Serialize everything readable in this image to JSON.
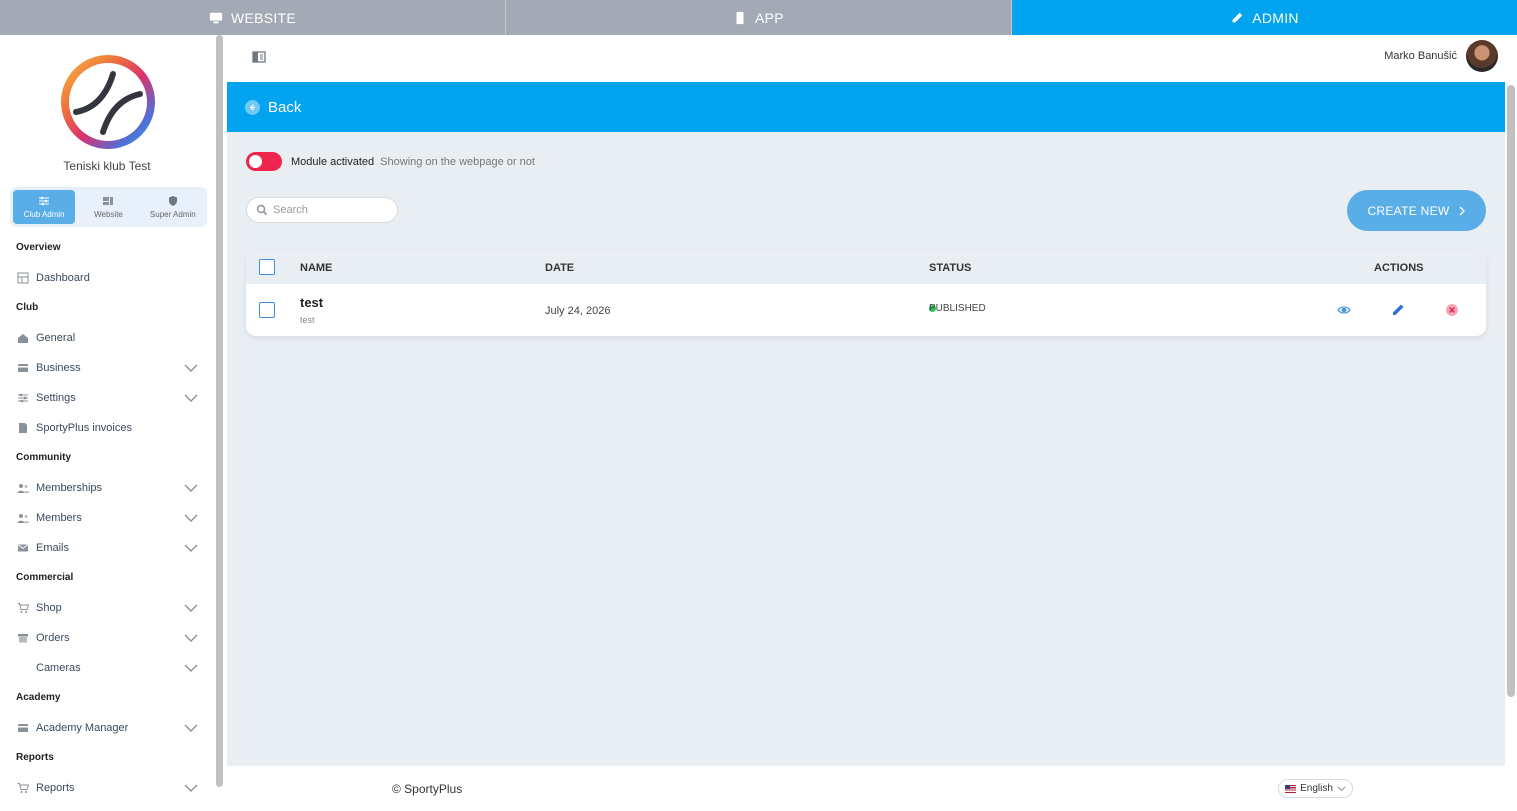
{
  "topbar": {
    "tabs": [
      {
        "label": "WEBSITE",
        "icon": "monitor-icon",
        "active": false
      },
      {
        "label": "APP",
        "icon": "phone-icon",
        "active": false
      },
      {
        "label": "ADMIN",
        "icon": "pen-icon",
        "active": true
      }
    ]
  },
  "sidebar": {
    "club_name": "Teniski klub Test",
    "roles": [
      {
        "label": "Club Admin",
        "icon": "sliders-icon",
        "active": true
      },
      {
        "label": "Website",
        "icon": "layout-icon",
        "active": false
      },
      {
        "label": "Super Admin",
        "icon": "shield-icon",
        "active": false
      }
    ],
    "sections": {
      "overview": "Overview",
      "club": "Club",
      "community": "Community",
      "commercial": "Commercial",
      "academy": "Academy",
      "reports": "Reports"
    },
    "items": {
      "dashboard": "Dashboard",
      "general": "General",
      "business": "Business",
      "settings": "Settings",
      "invoices": "SportyPlus invoices",
      "memberships": "Memberships",
      "members": "Members",
      "emails": "Emails",
      "shop": "Shop",
      "orders": "Orders",
      "cameras": "Cameras",
      "academy_manager": "Academy Manager",
      "reports": "Reports"
    }
  },
  "header": {
    "user_name": "Marko Banušić"
  },
  "main": {
    "back_label": "Back",
    "module": {
      "label": "Module activated",
      "description": "Showing on the webpage or not",
      "enabled": false
    },
    "search": {
      "placeholder": "Search",
      "value": ""
    },
    "create_label": "CREATE NEW",
    "table": {
      "columns": [
        "NAME",
        "DATE",
        "STATUS",
        "ACTIONS"
      ],
      "rows": [
        {
          "name": "test",
          "subtitle": "test",
          "date": "July 24, 2026",
          "status": "PUBLISHED",
          "status_color": "#22c55e"
        }
      ]
    }
  },
  "footer": {
    "copyright": "© SportyPlus",
    "language": "English"
  },
  "colors": {
    "accent": "#02a4ef",
    "button": "#5aaee8",
    "toggle": "#f0254d",
    "background": "#e9eef3"
  }
}
